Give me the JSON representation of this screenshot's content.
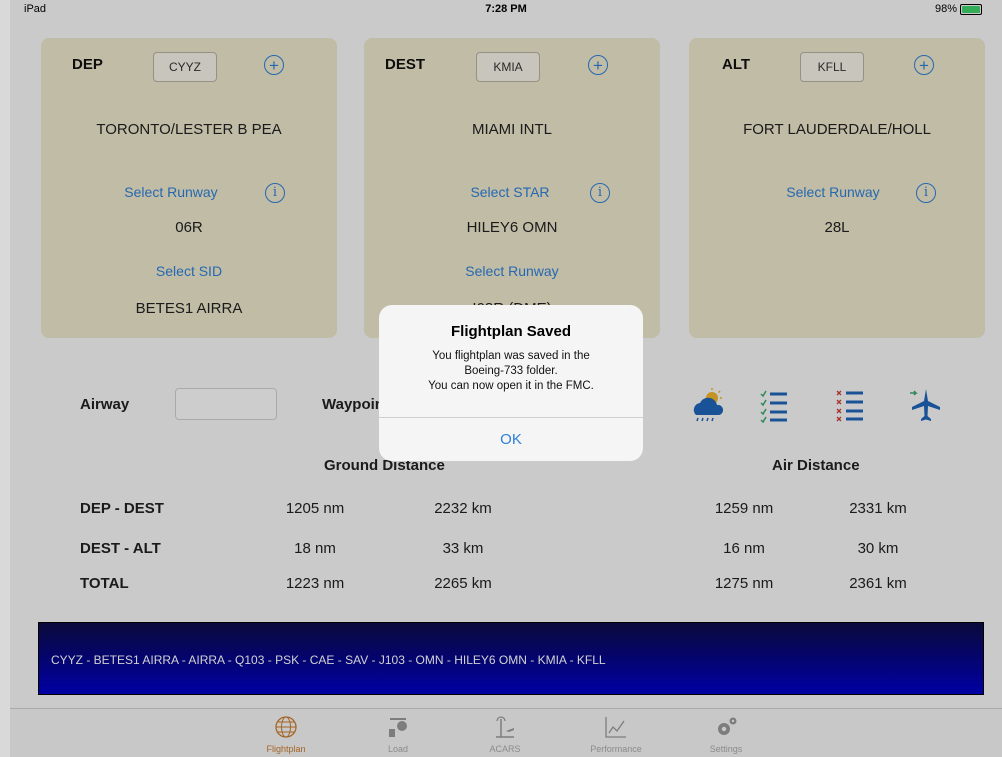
{
  "status_bar": {
    "device": "iPad",
    "time": "7:28 PM",
    "battery": "98%",
    "battery_level": 0.98
  },
  "dep": {
    "code_label": "DEP",
    "icao": "CYYZ",
    "name": "TORONTO/LESTER B PEA",
    "link1": "Select Runway",
    "value1": "06R",
    "link2": "Select SID",
    "value2": "BETES1 AIRRA"
  },
  "dest": {
    "code_label": "DEST",
    "icao": "KMIA",
    "name": "MIAMI INTL",
    "link1": "Select STAR",
    "value1": "HILEY6 OMN",
    "link2": "Select Runway",
    "value2": "I08R (DME)"
  },
  "alt": {
    "code_label": "ALT",
    "icao": "KFLL",
    "name": "FORT LAUDERDALE/HOLL",
    "link1": "Select Runway",
    "value1": "28L"
  },
  "airway": {
    "label": "Airway",
    "value": "",
    "waypoint_label": "Waypoint"
  },
  "icons": {
    "weather": "weather-icon",
    "checklist": "checklist-icon",
    "checklist_x": "checklist-x-icon",
    "airplane": "airplane-icon"
  },
  "distances": {
    "ground_header": "Ground Distance",
    "air_header": "Air Distance",
    "rows": [
      {
        "label": "DEP - DEST",
        "ground_nm": "1205 nm",
        "ground_km": "2232 km",
        "air_nm": "1259 nm",
        "air_km": "2331 km"
      },
      {
        "label": "DEST - ALT",
        "ground_nm": "18 nm",
        "ground_km": "33 km",
        "air_nm": "16 nm",
        "air_km": "30 km"
      },
      {
        "label": "TOTAL",
        "ground_nm": "1223 nm",
        "ground_km": "2265 km",
        "air_nm": "1275 nm",
        "air_km": "2361 km"
      }
    ]
  },
  "route": "CYYZ - BETES1 AIRRA - AIRRA - Q103 - PSK - CAE - SAV - J103 - OMN - HILEY6 OMN - KMIA - KFLL",
  "tabs": [
    {
      "label": "Flightplan",
      "icon": "globe-icon",
      "active": true
    },
    {
      "label": "Load",
      "icon": "load-icon",
      "active": false
    },
    {
      "label": "ACARS",
      "icon": "acars-icon",
      "active": false
    },
    {
      "label": "Performance",
      "icon": "performance-icon",
      "active": false
    },
    {
      "label": "Settings",
      "icon": "gear-icon",
      "active": false
    }
  ],
  "alert": {
    "title": "Flightplan Saved",
    "message_1": "You flightplan was saved in the",
    "message_2": "Boeing-733 folder.",
    "message_3": "You can now open it in the FMC.",
    "button": "OK"
  },
  "colors": {
    "accent": "#2f7fd7",
    "card": "#ebe6cb",
    "route_bar": "#0000c8",
    "tab_active": "#c87c2c"
  }
}
